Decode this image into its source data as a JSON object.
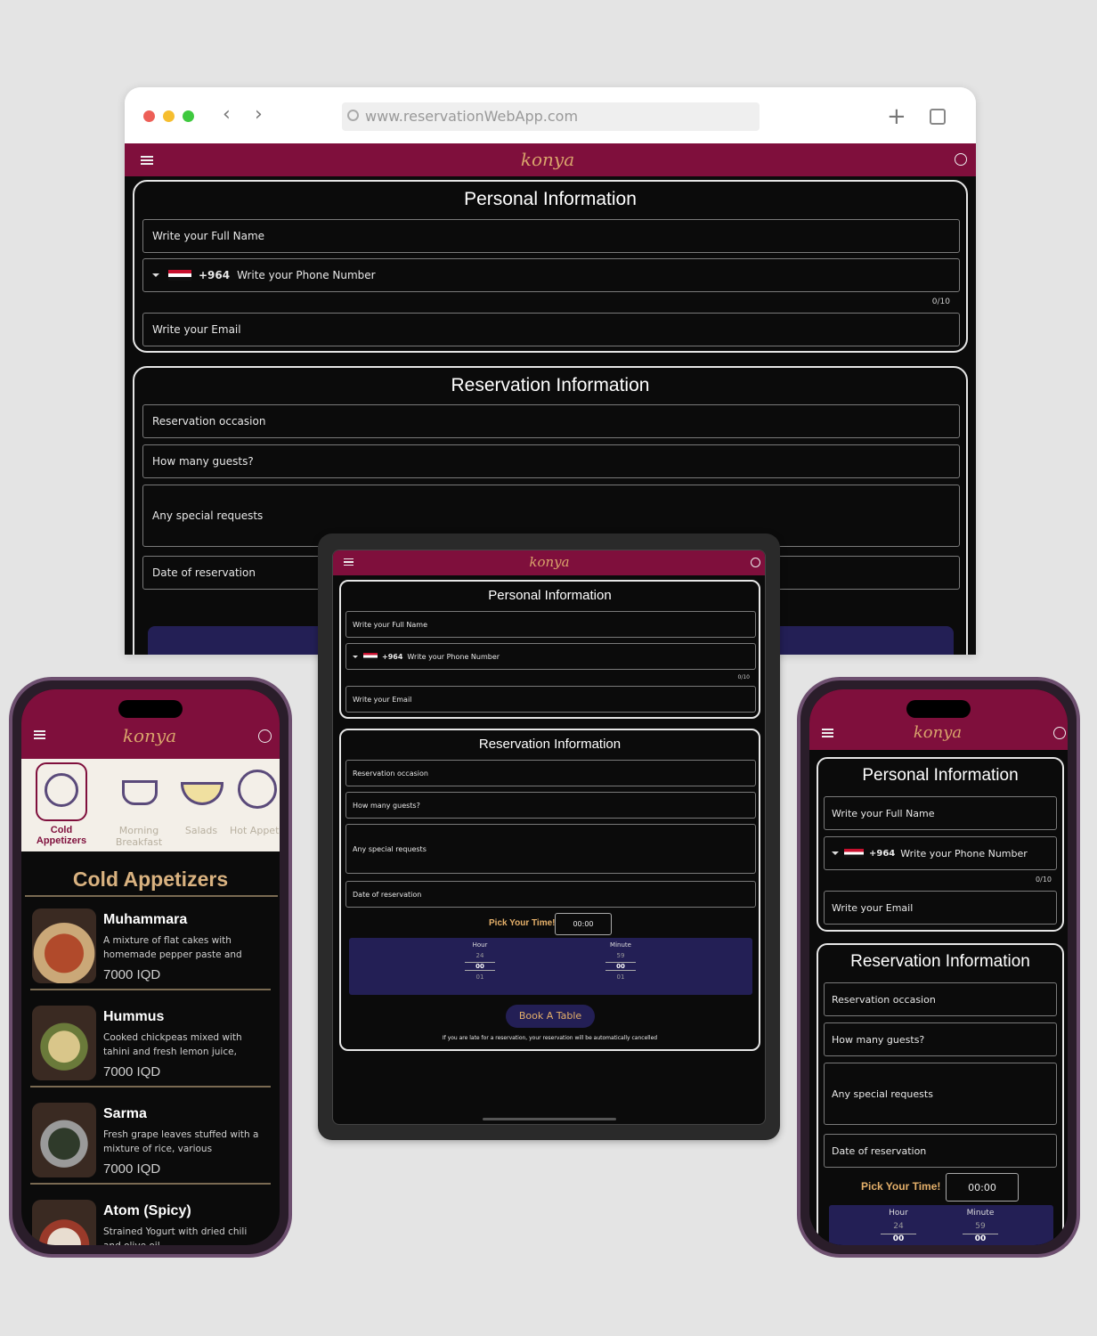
{
  "browser": {
    "url": "www.reservationWebApp.com",
    "traffic_colors": [
      "#ed5f57",
      "#f6be2f",
      "#3fc93f"
    ]
  },
  "brand": {
    "logo_text": "konya",
    "bar_color": "#7f0f3c",
    "accent_color": "#e5b06a",
    "panel_color": "#231f55"
  },
  "form": {
    "personal_title": "Personal Information",
    "full_name": "Write your Full Name",
    "phone_code": "+964",
    "phone": "Write your Phone Number",
    "phone_counter": "0/10",
    "email": "Write your Email",
    "reservation_title": "Reservation Information",
    "occasion": "Reservation occasion",
    "guests": "How many guests?",
    "requests": "Any special requests",
    "date": "Date of reservation",
    "pick_time": "Pick Your Time!",
    "time_value": "00:00",
    "hour_label": "Hour",
    "minute_label": "Minute",
    "hour_prev": "24",
    "hour_cur": "00",
    "hour_next": "01",
    "minute_prev": "59",
    "minute_cur": "00",
    "minute_next": "01",
    "book_button": "Book A Table",
    "late_note": "If you are late for a reservation, your reservation will be automatically cancelled"
  },
  "menu": {
    "categories": [
      "Cold Appetizers",
      "Morning Breakfast",
      "Salads",
      "Hot Appetiz"
    ],
    "section_title": "Cold Appetizers",
    "items": [
      {
        "name": "Muhammara",
        "desc": "A mixture of flat cakes with homemade pepper paste and assort...",
        "price": "7000 IQD"
      },
      {
        "name": "Hummus",
        "desc": "Cooked chickpeas mixed with tahini and fresh lemon juice, served after g...",
        "price": "7000 IQD"
      },
      {
        "name": "Sarma",
        "desc": "Fresh grape leaves stuffed with a mixture of rice, various vegetables a...",
        "price": "7000 IQD"
      },
      {
        "name": "Atom (Spicy)",
        "desc": "Strained Yogurt with dried chili and olive oil",
        "price": ""
      }
    ]
  }
}
